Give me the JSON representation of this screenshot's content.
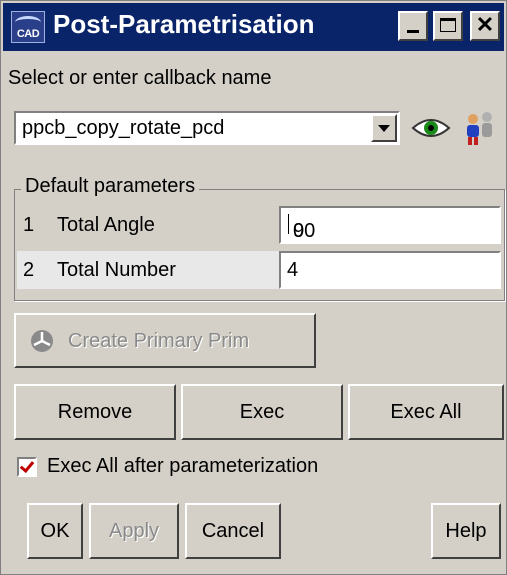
{
  "window": {
    "title": "Post-Parametrisation",
    "icon_text": "CAD"
  },
  "callback": {
    "prompt": "Select or enter callback name",
    "selected": "ppcb_copy_rotate_pcd"
  },
  "params": {
    "group_label": "Default parameters",
    "rows": [
      {
        "index": "1",
        "name": "Total Angle",
        "value_before_cursor": "90",
        "value_after_cursor": "0"
      },
      {
        "index": "2",
        "name": "Total Number",
        "value": "4"
      }
    ]
  },
  "buttons": {
    "create_primary": "Create Primary Prim",
    "remove": "Remove",
    "exec": "Exec",
    "exec_all": "Exec All",
    "ok": "OK",
    "apply": "Apply",
    "cancel": "Cancel",
    "help": "Help"
  },
  "options": {
    "exec_all_after_label": "Exec All after parameterization",
    "exec_all_after_checked": true
  },
  "colors": {
    "titlebar": "#0a246a",
    "face": "#d4d0c8",
    "checkmark": "#c00000"
  }
}
